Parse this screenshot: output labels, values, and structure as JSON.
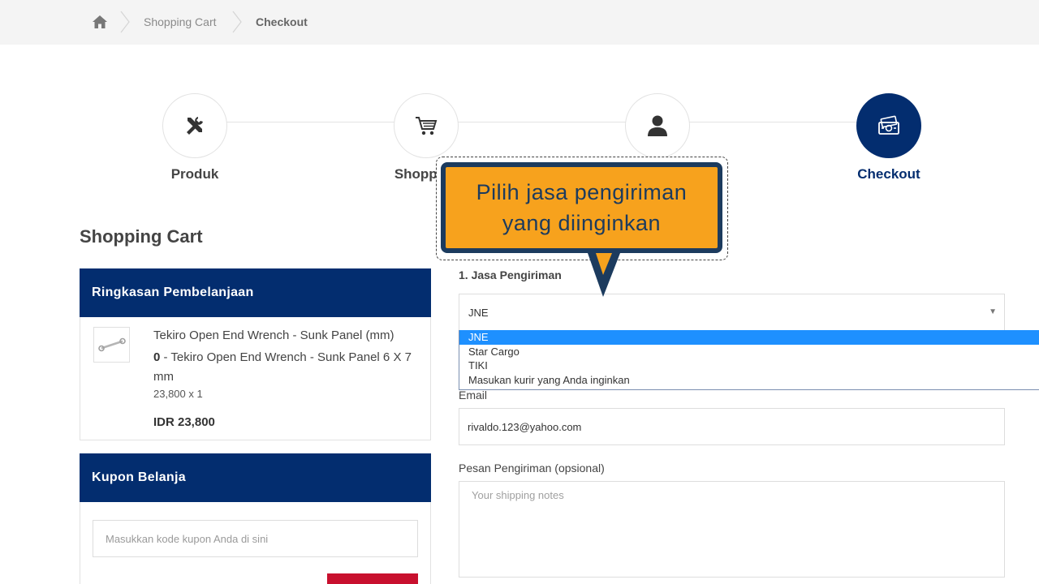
{
  "breadcrumb": {
    "home_icon": "home-icon",
    "items": [
      "Shopping Cart",
      "Checkout"
    ]
  },
  "steps": [
    {
      "label": "Produk",
      "icon": "tools-icon",
      "active": false
    },
    {
      "label": "Shopping",
      "icon": "cart-icon",
      "active": false
    },
    {
      "label": "",
      "icon": "user-icon",
      "active": false
    },
    {
      "label": "Checkout",
      "icon": "money-icon",
      "active": true
    }
  ],
  "page_title": "Shopping Cart",
  "summary": {
    "heading": "Ringkasan Pembelanjaan",
    "product_name": "Tekiro Open End Wrench - Sunk Panel (mm)",
    "variant_count": "0",
    "variant_name": " - Tekiro Open End Wrench - Sunk Panel 6 X 7 mm",
    "qty_line": "23,800 x 1",
    "total": "IDR 23,800"
  },
  "coupon": {
    "heading": "Kupon Belanja",
    "placeholder": "Masukkan kode kupon Anda di sini"
  },
  "shipping": {
    "label": "1. Jasa Pengiriman",
    "selected": "JNE",
    "options": [
      "JNE",
      "Star Cargo",
      "TIKI",
      "Masukan kurir yang Anda inginkan"
    ]
  },
  "email": {
    "label": "Email",
    "value": "rivaldo.123@yahoo.com"
  },
  "notes": {
    "label": "Pesan Pengiriman (opsional)",
    "placeholder": "Your shipping notes"
  },
  "callout": {
    "line1": "Pilih jasa pengiriman",
    "line2": "yang diinginkan"
  },
  "colors": {
    "primary": "#032d6f",
    "callout_bg": "#f7a21d",
    "callout_border": "#1c3b5e",
    "dropdown_highlight": "#1e90ff",
    "button_red": "#c8102e"
  }
}
